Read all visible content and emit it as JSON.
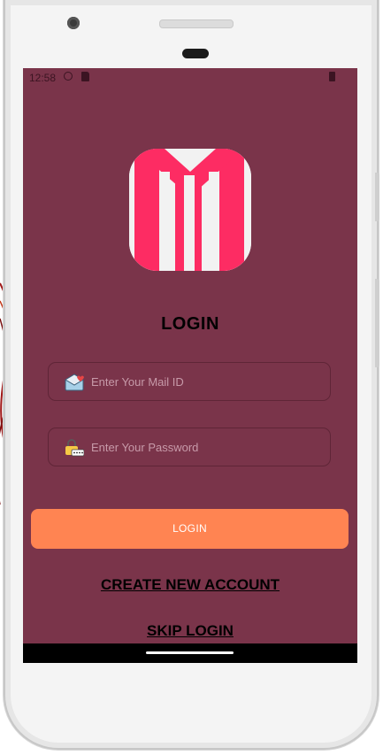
{
  "status_bar": {
    "time": "12:58"
  },
  "screen": {
    "title": "LOGIN",
    "email_field": {
      "placeholder": "Enter Your Mail ID",
      "value": ""
    },
    "password_field": {
      "placeholder": "Enter Your Password",
      "value": ""
    },
    "login_button_label": "LOGIN",
    "create_account_label": "CREATE NEW ACCOUNT",
    "skip_login_label": "SKIP LOGIN"
  },
  "icons": {
    "logo": "m-logo-icon",
    "email": "envelope-heart-icon",
    "password": "lock-password-icon"
  },
  "colors": {
    "screen_background": "#7a344a",
    "login_button": "#ff8452",
    "logo_accent": "#fd2c63"
  }
}
